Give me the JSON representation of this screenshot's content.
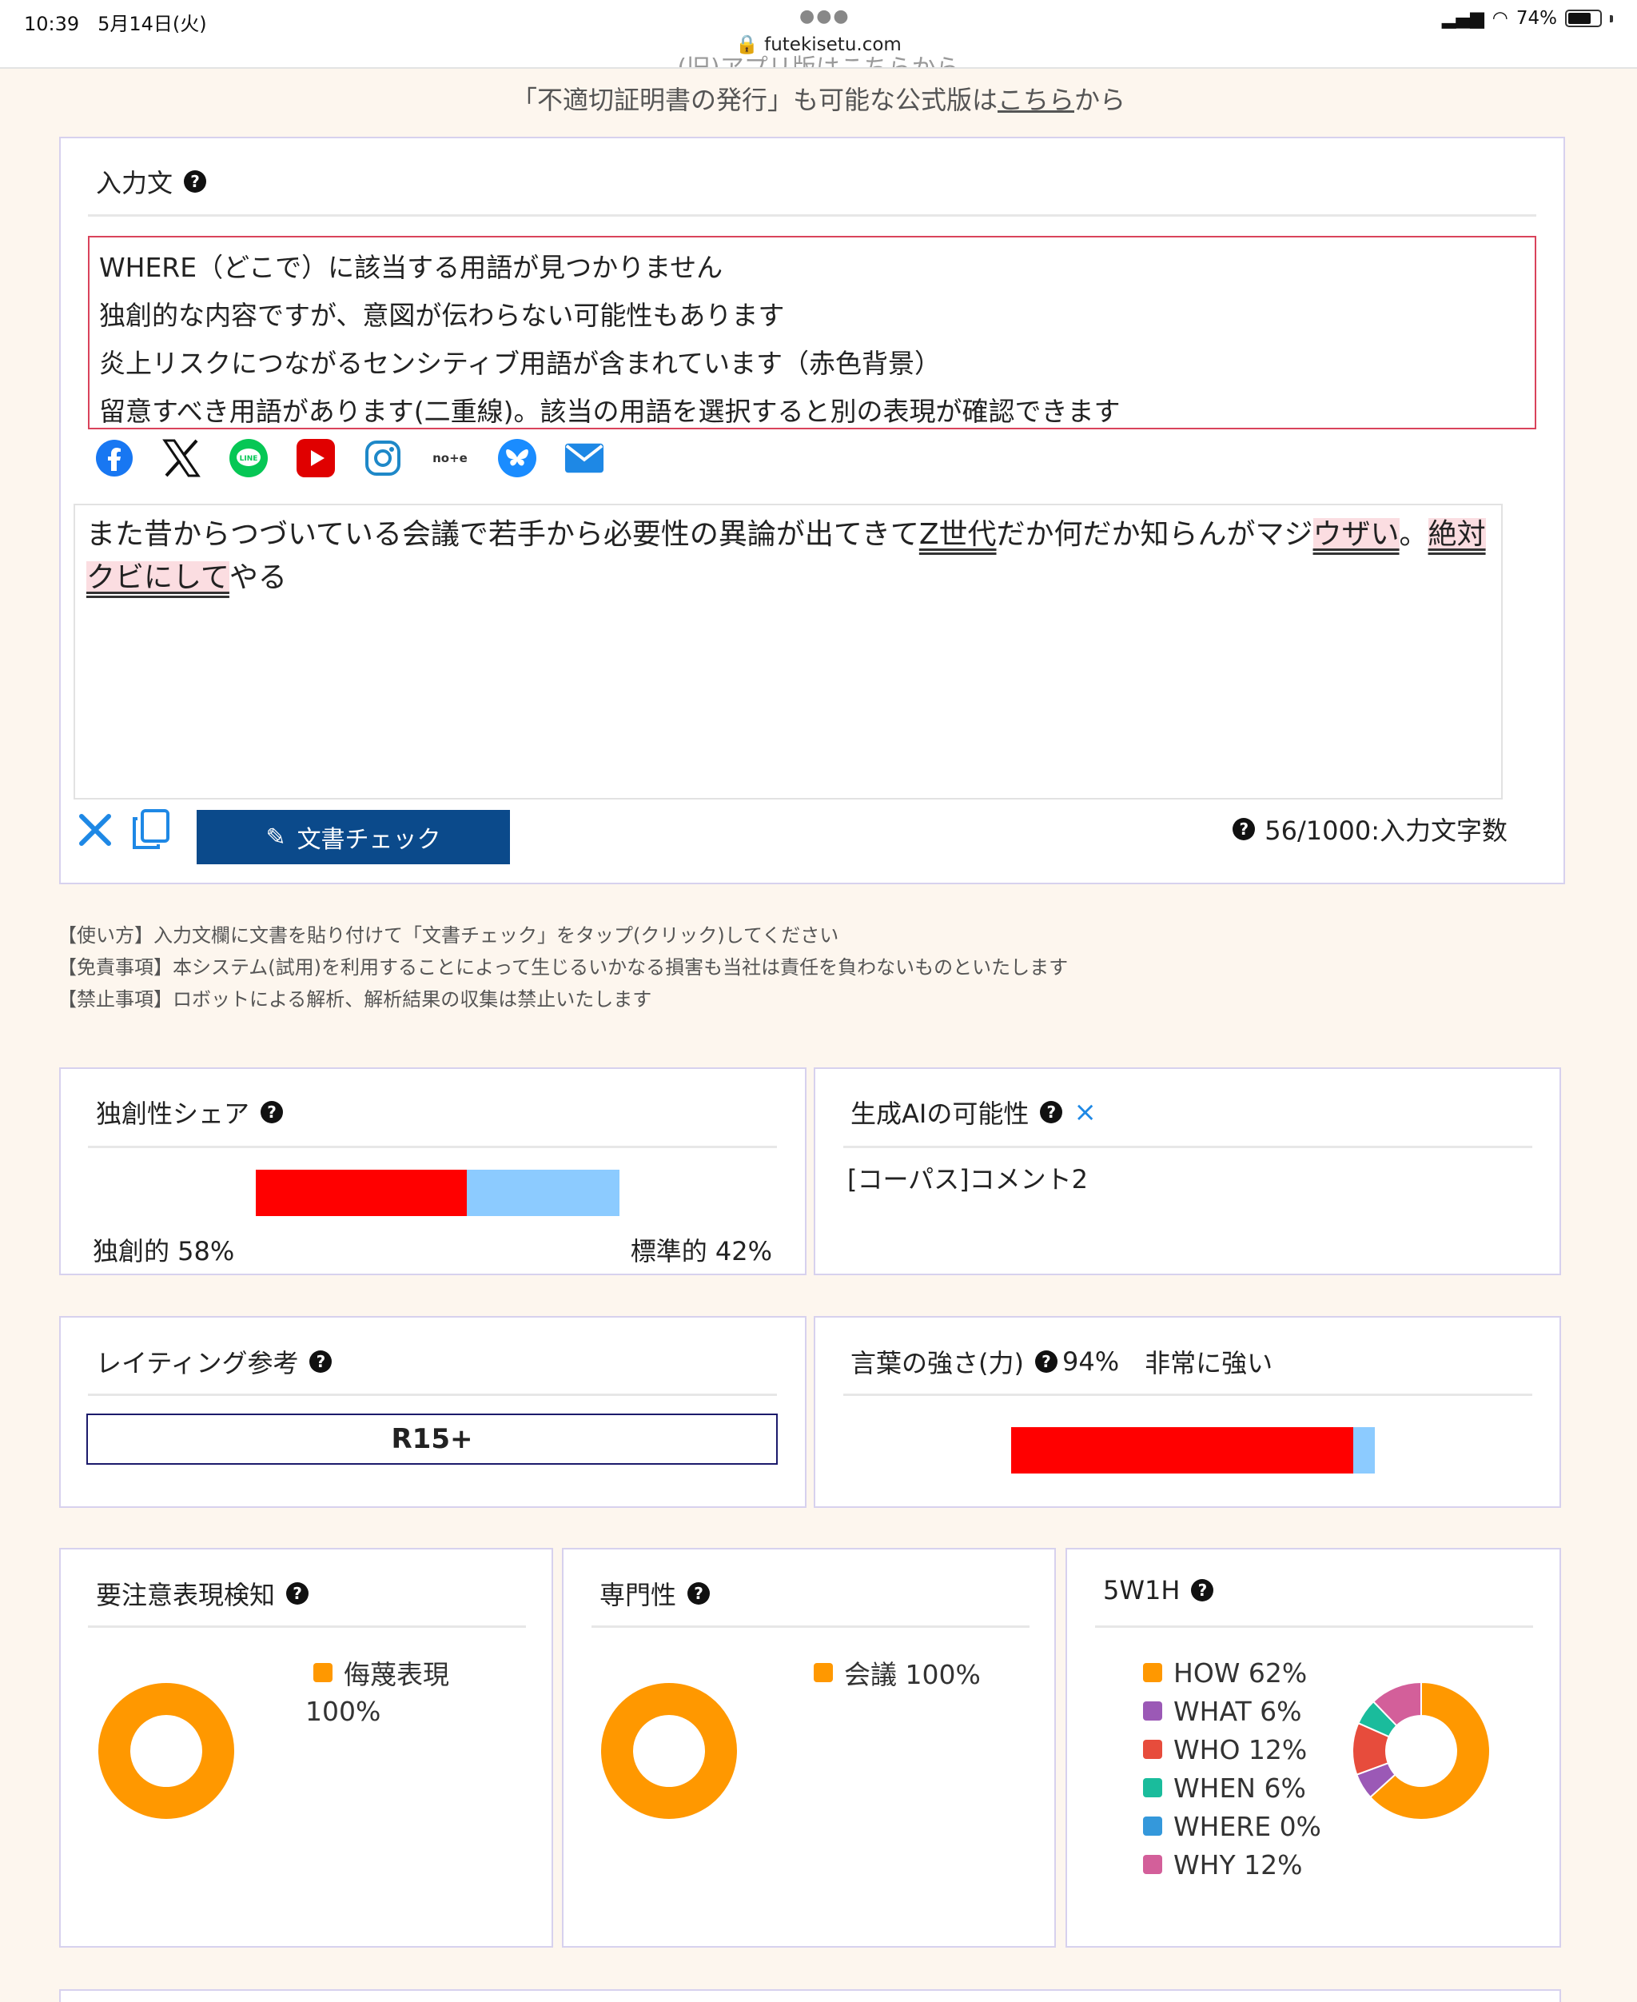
{
  "status_bar": {
    "time": "10:39",
    "date": "5月14日(火)",
    "url": "futekisetu.com",
    "battery": "74%",
    "battery_level": 0.74
  },
  "notice": {
    "cut_text": "(旧)アプリ版はこちらから",
    "text_before": "「不適切証明書の発行」も可能な公式版は",
    "link": "こちら",
    "text_after": "から"
  },
  "input_panel": {
    "title": "入力文",
    "warnings": [
      "WHERE（どこで）に該当する用語が見つかりません",
      "独創的な内容ですが、意図が伝わらない可能性もあります",
      "炎上リスクにつながるセンシティブ用語が含まれています（赤色背景）",
      "留意すべき用語があります(二重線)。該当の用語を選択すると別の表現が確認できます"
    ],
    "share_icons": [
      "facebook-icon",
      "x-icon",
      "line-icon",
      "youtube-icon",
      "instagram-icon",
      "note-icon",
      "bluesky-icon",
      "mail-icon"
    ],
    "text_segments": {
      "s1": "また昔からつづいている会議で若手から必要性の異論が出てきて",
      "s2": "Z世代",
      "s3": "だか何だか知らんがマジ",
      "s4": "ウザい",
      "s5": "。",
      "s6": "絶対クビにして",
      "s7": "やる"
    },
    "check_button": "文書チェック",
    "char_count": "56/1000:入力文字数"
  },
  "usage": [
    "【使い方】入力文欄に文書を貼り付けて「文書チェック」をタップ(クリック)してください",
    "【免責事項】本システム(試用)を利用することによって生じるいかなる損害も当社は責任を負わないものといたします",
    "【禁止事項】ロボットによる解析、解析結果の収集は禁止いたします"
  ],
  "originality": {
    "title": "独創性シェア",
    "original_label": "独創的 58%",
    "standard_label": "標準的 42%",
    "original_share": 0.58,
    "standard_share": 0.42,
    "colors": {
      "original": "#ff0000",
      "standard": "#8ccbff"
    }
  },
  "gen_ai": {
    "title": "生成AIの可能性",
    "comment": "[コーパス]コメント2"
  },
  "rating": {
    "title": "レイティング参考",
    "value": "R15+"
  },
  "strength": {
    "title": "言葉の強さ(力)",
    "percent": "94%",
    "label": "非常に強い",
    "value": 0.94
  },
  "caution": {
    "title": "要注意表現検知",
    "legend_label": "侮蔑表現",
    "legend_value": "100%",
    "chart_data": {
      "type": "pie",
      "labels": [
        "侮蔑表現"
      ],
      "values": [
        100
      ],
      "colors": [
        "#ff9800"
      ]
    }
  },
  "expertise": {
    "title": "専門性",
    "legend_label": "会議 100%",
    "chart_data": {
      "type": "pie",
      "labels": [
        "会議"
      ],
      "values": [
        100
      ],
      "colors": [
        "#ff9800"
      ]
    }
  },
  "fivew": {
    "title": "5W1H",
    "legend": [
      "HOW 62%",
      "WHAT 6%",
      "WHO 12%",
      "WHEN 6%",
      "WHERE 0%",
      "WHY 12%"
    ],
    "chart_data": {
      "type": "pie",
      "labels": [
        "HOW",
        "WHAT",
        "WHO",
        "WHEN",
        "WHERE",
        "WHY"
      ],
      "values": [
        62,
        6,
        12,
        6,
        0,
        12
      ],
      "colors": [
        "#ff9800",
        "#9b59b6",
        "#e74c3c",
        "#1abc9c",
        "#3498db",
        "#d35f9a"
      ]
    }
  }
}
